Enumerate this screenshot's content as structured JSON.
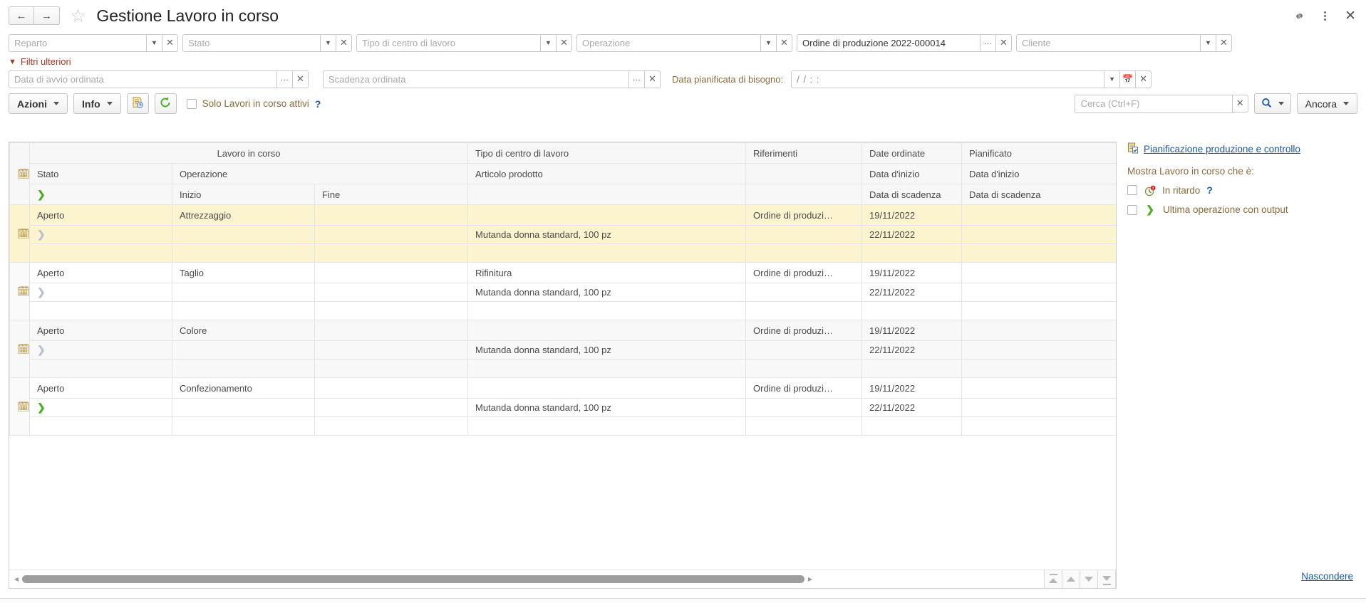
{
  "window": {
    "title": "Gestione Lavoro in corso",
    "back_icon": "arrow-left-icon",
    "forward_icon": "arrow-right-icon",
    "favorite_icon": "star-icon",
    "link_icon": "link-icon",
    "more_icon": "more-vertical-icon",
    "close_icon": "close-icon"
  },
  "filters_primary": [
    {
      "name": "reparto",
      "placeholder": "Reparto",
      "value": "",
      "has_dropdown": true,
      "has_ellipsis": false
    },
    {
      "name": "stato",
      "placeholder": "Stato",
      "value": "",
      "has_dropdown": true,
      "has_ellipsis": false
    },
    {
      "name": "tipo-centro-lavoro",
      "placeholder": "Tipo di centro di lavoro",
      "value": "",
      "has_dropdown": true,
      "has_ellipsis": false
    },
    {
      "name": "operazione",
      "placeholder": "Operazione",
      "value": "",
      "has_dropdown": true,
      "has_ellipsis": false
    },
    {
      "name": "ordine-produzione",
      "placeholder": "Ordine di produzione",
      "value": "Ordine di produzione 2022-000014",
      "has_dropdown": false,
      "has_ellipsis": true
    },
    {
      "name": "cliente",
      "placeholder": "Cliente",
      "value": "",
      "has_dropdown": true,
      "has_ellipsis": false
    }
  ],
  "further_filters": {
    "toggle_label": "Filtri ulteriori",
    "expanded": true,
    "fields": [
      {
        "name": "data-avvio-ordinata",
        "placeholder": "Data di avvio ordinata",
        "value": "",
        "has_ellipsis": true
      },
      {
        "name": "scadenza-ordinata",
        "placeholder": "Scadenza ordinata",
        "value": "",
        "has_ellipsis": true
      }
    ],
    "planned_date": {
      "label": "Data pianificata di bisogno:",
      "value": "/ /     :  :"
    }
  },
  "toolbar": {
    "azioni_label": "Azioni",
    "info_label": "Info",
    "report_icon": "report-document-icon",
    "refresh_icon": "refresh-icon",
    "active_only_label": "Solo Lavori in corso attivi",
    "active_only_checked": false,
    "help_marker": "?",
    "search_placeholder": "Cerca (Ctrl+F)",
    "search_value": "",
    "search_icon": "magnifier-icon",
    "more_label": "Ancora"
  },
  "grid": {
    "header": {
      "line1": [
        "Lavoro in corso",
        "Tipo di centro di lavoro",
        "Riferimenti",
        "Date ordinate",
        "Pianificato"
      ],
      "line2": [
        "Stato",
        "Operazione",
        "",
        "Articolo prodotto",
        "",
        "Data d'inizio",
        "Data d'inizio"
      ],
      "line3": [
        "",
        "Inizio",
        "Fine",
        "",
        "",
        "Data di scadenza",
        "Data di scadenza"
      ]
    },
    "rows": [
      {
        "highlight": "selected",
        "row_icon": "calendar-record-icon",
        "expand_icon": "chevron-right-grey-icon",
        "stato": "Aperto",
        "operazione": "Attrezzaggio",
        "inizio": "",
        "fine": "",
        "tipo_centro": "",
        "articolo": "Mutanda donna standard, 100 pz",
        "riferimenti": "Ordine di produzi…",
        "data_inizio_ordinata": "19/11/2022",
        "data_scadenza_ordinata": "22/11/2022",
        "data_inizio_pianificata": "",
        "data_scadenza_pianificata": ""
      },
      {
        "highlight": "white",
        "row_icon": "calendar-record-icon",
        "expand_icon": "chevron-right-grey-icon",
        "stato": "Aperto",
        "operazione": "Taglio",
        "inizio": "",
        "fine": "",
        "tipo_centro": "Rifinitura",
        "articolo": "Mutanda donna standard, 100 pz",
        "riferimenti": "Ordine di produzi…",
        "data_inizio_ordinata": "19/11/2022",
        "data_scadenza_ordinata": "22/11/2022",
        "data_inizio_pianificata": "",
        "data_scadenza_pianificata": ""
      },
      {
        "highlight": "alt",
        "row_icon": "calendar-record-icon",
        "expand_icon": "chevron-right-grey-icon",
        "stato": "Aperto",
        "operazione": "Colore",
        "inizio": "",
        "fine": "",
        "tipo_centro": "",
        "articolo": "Mutanda donna standard, 100 pz",
        "riferimenti": "Ordine di produzi…",
        "data_inizio_ordinata": "19/11/2022",
        "data_scadenza_ordinata": "22/11/2022",
        "data_inizio_pianificata": "",
        "data_scadenza_pianificata": ""
      },
      {
        "highlight": "white",
        "row_icon": "calendar-record-icon",
        "expand_icon": "chevron-right-green-icon",
        "stato": "Aperto",
        "operazione": "Confezionamento",
        "inizio": "",
        "fine": "",
        "tipo_centro": "",
        "articolo": "Mutanda donna standard, 100 pz",
        "riferimenti": "Ordine di produzi…",
        "data_inizio_ordinata": "19/11/2022",
        "data_scadenza_ordinata": "22/11/2022",
        "data_inizio_pianificata": "",
        "data_scadenza_pianificata": ""
      }
    ],
    "footer": {
      "scroll_left_icon": "triangle-left-icon",
      "scroll_right_icon": "triangle-right-icon",
      "nav_first": "go-first-icon",
      "nav_prev": "go-previous-icon",
      "nav_next": "go-next-icon",
      "nav_last": "go-last-icon"
    }
  },
  "right_panel": {
    "link_icon": "planning-board-icon",
    "link_label": "Pianificazione produzione e controllo",
    "subtitle": "Mostra Lavoro in corso che è:",
    "options": [
      {
        "name": "in-ritardo",
        "icon": "late-clock-icon",
        "label": "In ritardo",
        "checked": false,
        "help": "?"
      },
      {
        "name": "ultima-operazione-con-output",
        "icon": "chevron-right-green-icon",
        "label": "Ultima operazione con output",
        "checked": false,
        "help": ""
      }
    ],
    "hide_label": "Nascondere"
  },
  "colors": {
    "accent_link": "#1a55a8",
    "label_brown": "#8a6a3a",
    "filter_toggle_red": "#a03b25",
    "row_highlight": "#fcf4cf",
    "green": "#4caf22"
  }
}
